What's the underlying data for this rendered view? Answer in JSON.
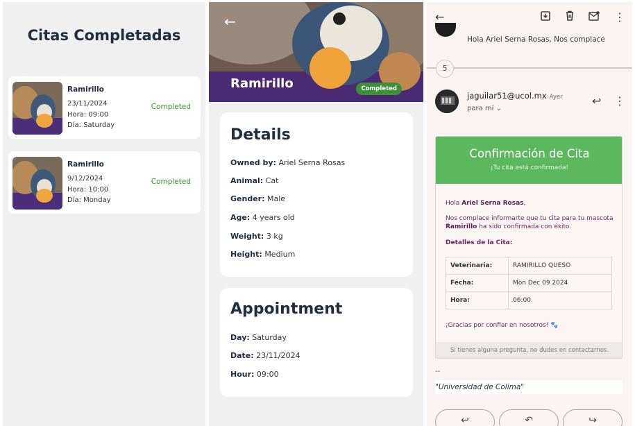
{
  "appointments_list": {
    "title": "Citas Completadas",
    "items": [
      {
        "name": "Ramirillo",
        "date": "23/11/2024",
        "time": "Hora: 09:00",
        "day": "Día: Saturday",
        "status": "Completed"
      },
      {
        "name": "Ramirillo",
        "date": "9/12/2024",
        "time": "Hora: 10:00",
        "day": "Día: Monday",
        "status": "Completed"
      }
    ]
  },
  "pet_detail": {
    "name": "Ramirillo",
    "badge": "Completed",
    "details_title": "Details",
    "details": [
      {
        "label": "Owned by:",
        "value": "Ariel Serna Rosas"
      },
      {
        "label": "Animal:",
        "value": "Cat"
      },
      {
        "label": "Gender:",
        "value": "Male"
      },
      {
        "label": "Age:",
        "value": "4 years old"
      },
      {
        "label": "Weight:",
        "value": "3 kg"
      },
      {
        "label": "Height:",
        "value": "Medium"
      }
    ],
    "appointment_title": "Appointment",
    "appointment": [
      {
        "label": "Day:",
        "value": "Saturday"
      },
      {
        "label": "Date:",
        "value": "23/11/2024"
      },
      {
        "label": "Hour:",
        "value": "09:00"
      }
    ]
  },
  "email": {
    "prev_snippet": "Hola Ariel Serna Rosas, Nos complace",
    "collapsed_count": "5",
    "sender": "jaguilar51@ucol.mx",
    "when": "Ayer",
    "to": "para mí",
    "header_title": "Confirmación de Cita",
    "header_subtitle": "¡Tu cita está confirmada!",
    "greeting_prefix": "Hola ",
    "greeting_name": "Ariel Serna Rosas",
    "greeting_suffix": ",",
    "body_prefix": "Nos complace informarte que tu cita para tu mascota",
    "body_pet": "Ramirillo",
    "body_suffix": " ha sido confirmada con éxito.",
    "details_heading": "Detalles de la Cita:",
    "table": [
      {
        "key": "Veterinaria:",
        "value": "RAMIRILLO QUESO"
      },
      {
        "key": "Fecha:",
        "value": "Mon Dec 09 2024"
      },
      {
        "key": "Hora:",
        "value": "06:00"
      }
    ],
    "thanks": "¡Gracias por confiar en nosotros! 🐾",
    "footer": "Si tienes alguna pregunta, no dudes en contactarnos.",
    "sig_dash": "--",
    "signature": "\"Universidad de Colima\""
  },
  "colors": {
    "green": "#5cb85c",
    "status_green": "#3f8f3a",
    "title_navy": "#1f2d3d"
  },
  "icons": [
    "back-arrow-icon",
    "archive-icon",
    "trash-icon",
    "mark-unread-icon",
    "more-vert-icon",
    "reply-icon",
    "chevron-down-icon",
    "reply-all-icon",
    "forward-icon"
  ]
}
